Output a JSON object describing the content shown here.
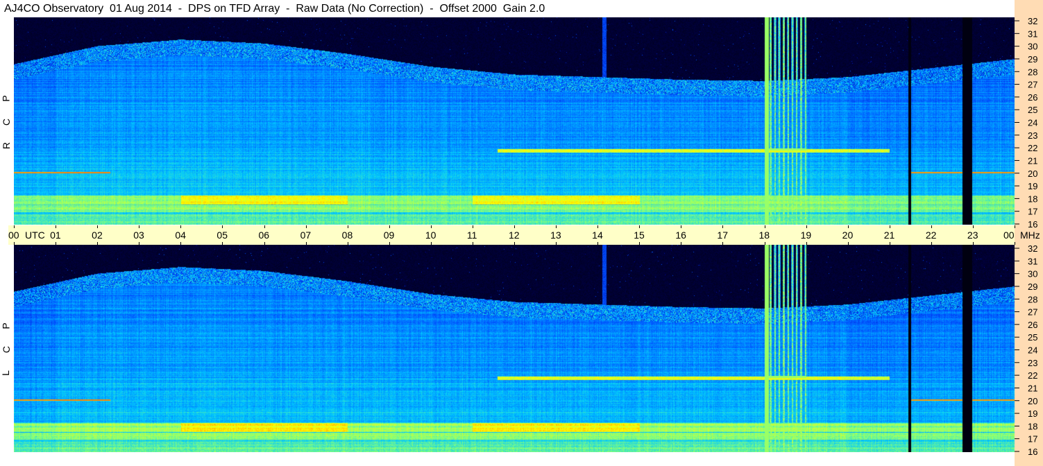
{
  "title": "AJ4CO Observatory  01 Aug 2014  -  DPS on TFD Array  -  Raw Data (No Correction)  -  Offset 2000  Gain 2.0",
  "chart_data": {
    "type": "heatmap",
    "subtype": "radio spectrogram (dynamic spectrum)",
    "x_axis": {
      "unit": "UTC",
      "ticks": [
        "00",
        "01",
        "02",
        "03",
        "04",
        "05",
        "06",
        "07",
        "08",
        "09",
        "10",
        "11",
        "12",
        "13",
        "14",
        "15",
        "16",
        "17",
        "18",
        "19",
        "20",
        "21",
        "22",
        "23",
        "00"
      ],
      "range_hours": [
        0,
        24
      ]
    },
    "y_axis": {
      "unit": "MHz",
      "ticks": [
        16,
        17,
        18,
        19,
        20,
        21,
        22,
        23,
        24,
        25,
        26,
        27,
        28,
        29,
        30,
        31,
        32
      ],
      "range": [
        16,
        32
      ]
    },
    "panels": [
      {
        "polarization": "R C P",
        "letters": [
          "R",
          "C",
          "P"
        ]
      },
      {
        "polarization": "L C P",
        "letters": [
          "L",
          "C",
          "P"
        ]
      }
    ],
    "features": {
      "ionospheric_cutoff_hours": [
        0,
        2,
        4,
        6,
        8,
        10,
        12,
        14,
        16,
        18,
        20,
        22,
        24
      ],
      "ionospheric_cutoff_mhz": [
        27.8,
        29.2,
        29.7,
        29.4,
        28.6,
        27.6,
        27.0,
        26.8,
        26.6,
        26.5,
        26.8,
        27.5,
        28.2
      ],
      "strong_bands_mhz": [
        17.2,
        17.9
      ],
      "intermittent_line_mhz": 21.7,
      "intermittent_line_hours": [
        11.6,
        21.0
      ],
      "interference_line_mhz": 20.0,
      "broadband_burst_hours": [
        18.0,
        19.0
      ],
      "data_gaps_hours": [
        [
          21.45,
          21.52
        ],
        [
          22.75,
          22.97
        ]
      ],
      "narrow_column_hours": [
        14.1,
        14.2
      ]
    },
    "colormap": [
      "#000010",
      "#00009a",
      "#0050ff",
      "#00c8ff",
      "#80ff80",
      "#ffff00",
      "#ff8000",
      "#ff00c0"
    ]
  }
}
